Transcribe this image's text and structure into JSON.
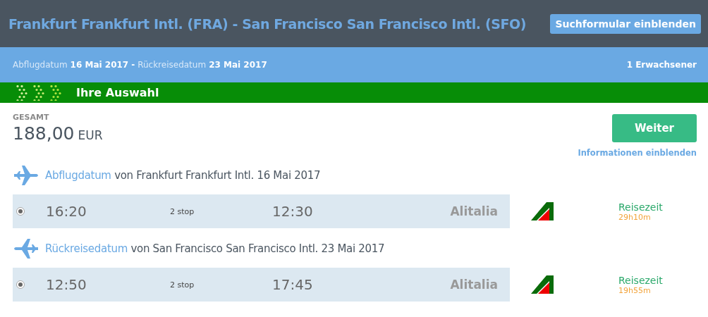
{
  "header": {
    "title": "Frankfurt Frankfurt Intl. (FRA) - San Francisco San Francisco Intl. (SFO)",
    "button": "Suchformular einblenden"
  },
  "info_bar": {
    "departure_label": "Abflugdatum",
    "departure_date": "16 Mai 2017",
    "separator": "-",
    "return_label": "Rückreisedatum",
    "return_date": "23 Mai 2017",
    "passengers": "1 Erwachsener"
  },
  "step_bar": {
    "title": "Ihre Auswahl"
  },
  "summary": {
    "total_label": "GESAMT",
    "amount": "188,00",
    "currency": "EUR",
    "continue_button": "Weiter",
    "info_link": "Informationen einblenden"
  },
  "legs": [
    {
      "kind": "outbound",
      "label": "Abflugdatum",
      "route": "von Frankfurt Frankfurt Intl. 16 Mai 2017",
      "flights": [
        {
          "selected": true,
          "departure": "16:20",
          "stops": "2 stop",
          "arrival": "12:30",
          "airline": "Alitalia",
          "duration_label": "Reisezeit",
          "duration": "29h10m"
        }
      ]
    },
    {
      "kind": "return",
      "label": "Rückreisedatum",
      "route": "von San Francisco San Francisco Intl. 23 Mai 2017",
      "flights": [
        {
          "selected": true,
          "departure": "12:50",
          "stops": "2 stop",
          "arrival": "17:45",
          "airline": "Alitalia",
          "duration_label": "Reisezeit",
          "duration": "19h55m"
        }
      ]
    }
  ]
}
